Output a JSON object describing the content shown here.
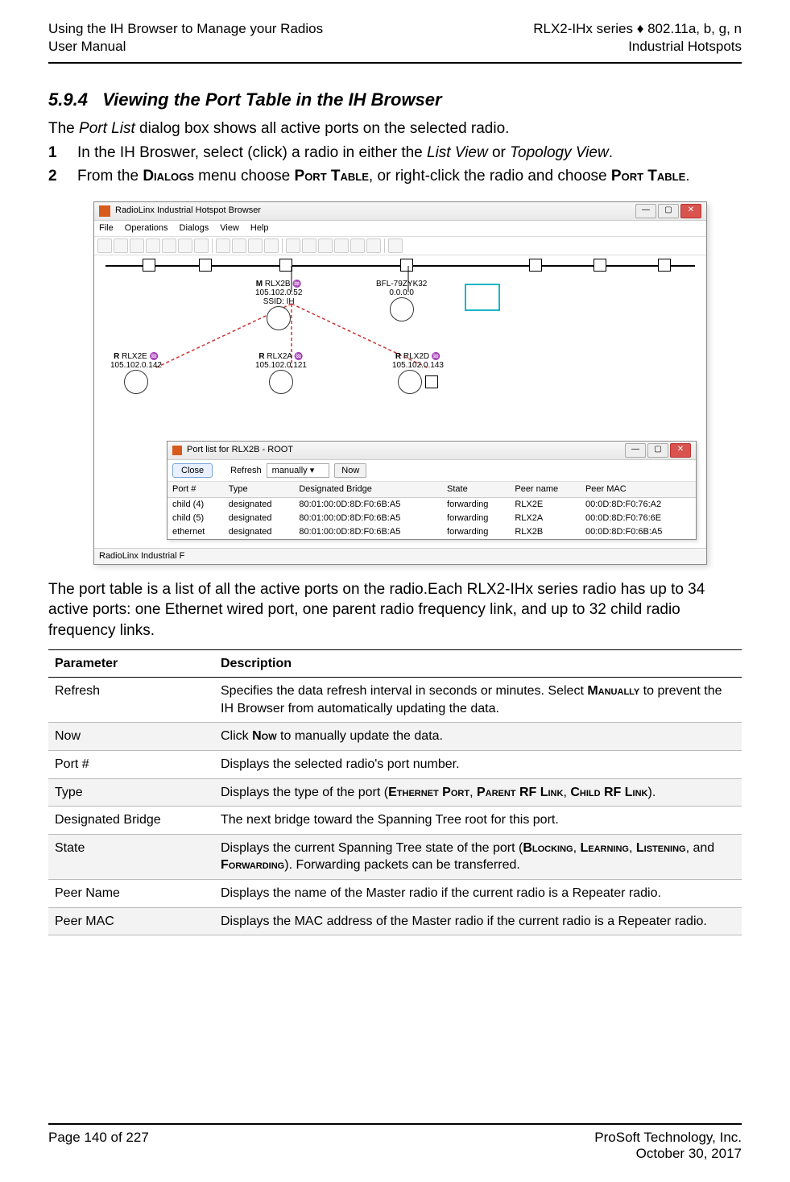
{
  "header": {
    "left1": "Using the IH Browser to Manage your Radios",
    "left2": "User Manual",
    "right1": "RLX2-IHx series ♦ 802.11a, b, g, n",
    "right2": "Industrial Hotspots"
  },
  "section": {
    "number": "5.9.4",
    "title": "Viewing the Port Table in the IH Browser"
  },
  "intro": {
    "pre": "The ",
    "port_list": "Port List",
    "post": " dialog box shows all active ports on the selected radio."
  },
  "steps": [
    {
      "num": "1",
      "t1": "In the IH Broswer, select (click) a radio in either the ",
      "i1": "List View",
      "t2": " or ",
      "i2": "Topology View",
      "t3": "."
    },
    {
      "num": "2",
      "t1": "From the ",
      "sc1": "Dialogs",
      "t2": " menu choose ",
      "sc2": "Port Table",
      "t3": ", or right-click the radio and choose ",
      "sc3": "Port Table",
      "t4": "."
    }
  ],
  "browser": {
    "title": "RadioLinx Industrial Hotspot Browser",
    "menus": [
      "File",
      "Operations",
      "Dialogs",
      "View",
      "Help"
    ],
    "toolbar_icons": [
      "binoc",
      "wand",
      "hand",
      "plus",
      "tree",
      "tree2",
      "props",
      "lines",
      "grid",
      "page",
      "topo1",
      "topo2",
      "zoom",
      "zoomin",
      "zoomout",
      "doc",
      "help"
    ]
  },
  "topology": {
    "master": {
      "tag": "M",
      "name": "RLX2B",
      "ip": "105.102.0.52",
      "ssid": "SSID: IH"
    },
    "bfl": {
      "name": "BFL-79ZYK32",
      "ip": "0.0.0.0"
    },
    "repeaters": [
      {
        "tag": "R",
        "name": "RLX2E",
        "ip": "105.102.0.142"
      },
      {
        "tag": "R",
        "name": "RLX2A",
        "ip": "105.102.0.121"
      },
      {
        "tag": "R",
        "name": "RLX2D",
        "ip": "105.102.0.143"
      }
    ]
  },
  "portlist": {
    "title": "Port list for RLX2B - ROOT",
    "close": "Close",
    "refresh_label": "Refresh",
    "refresh_value": "manually",
    "now": "Now",
    "columns": [
      "Port #",
      "Type",
      "Designated Bridge",
      "State",
      "Peer name",
      "Peer MAC"
    ],
    "rows": [
      [
        "child (4)",
        "designated",
        "80:01:00:0D:8D:F0:6B:A5",
        "forwarding",
        "RLX2E",
        "00:0D:8D:F0:76:A2"
      ],
      [
        "child (5)",
        "designated",
        "80:01:00:0D:8D:F0:6B:A5",
        "forwarding",
        "RLX2A",
        "00:0D:8D:F0:76:6E"
      ],
      [
        "ethernet",
        "designated",
        "80:01:00:0D:8D:F0:6B:A5",
        "forwarding",
        "RLX2B",
        "00:0D:8D:F0:6B:A5"
      ]
    ]
  },
  "status_strip": "RadioLinx Industrial F",
  "after_img": "The port table is a list of all the active ports on the radio.Each RLX2-IHx series radio has up to 34 active ports: one Ethernet wired port, one parent radio frequency link, and up to 32 child radio frequency links.",
  "table": {
    "head": [
      "Parameter",
      "Description"
    ],
    "rows": [
      {
        "p": "Refresh",
        "d_pre": "Specifies the data refresh interval in seconds or minutes. Select ",
        "sc": "Manually",
        "d_post": " to prevent the IH Browser from automatically updating the data."
      },
      {
        "p": "Now",
        "d_pre": "Click ",
        "sc": "Now",
        "d_post": " to manually update the data."
      },
      {
        "p": "Port #",
        "d": "Displays the selected radio's port number."
      },
      {
        "p": "Type",
        "d_pre": "Displays the type of the port (",
        "sc1": "Ethernet Port",
        "m1": ", ",
        "sc2": "Parent RF Link",
        "m2": ", ",
        "sc3": "Child RF Link",
        "d_post": ")."
      },
      {
        "p": "Designated Bridge",
        "d": "The next bridge toward the Spanning Tree root for this port."
      },
      {
        "p": "State",
        "d_pre": "Displays the current Spanning Tree state of the port (",
        "sc1": "Blocking",
        "m1": ", ",
        "sc2": "Learning",
        "m2": ", ",
        "sc3": "Listening",
        "m3": ", and ",
        "sc4": "Forwarding",
        "d_post": "). Forwarding packets can be transferred."
      },
      {
        "p": "Peer Name",
        "d": "Displays the name of the Master radio if the current radio is a Repeater radio."
      },
      {
        "p": "Peer MAC",
        "d": "Displays the MAC address of the Master radio if the current radio is a Repeater radio."
      }
    ]
  },
  "footer": {
    "left": "Page 140 of 227",
    "right1": "ProSoft Technology, Inc.",
    "right2": "October 30, 2017"
  }
}
